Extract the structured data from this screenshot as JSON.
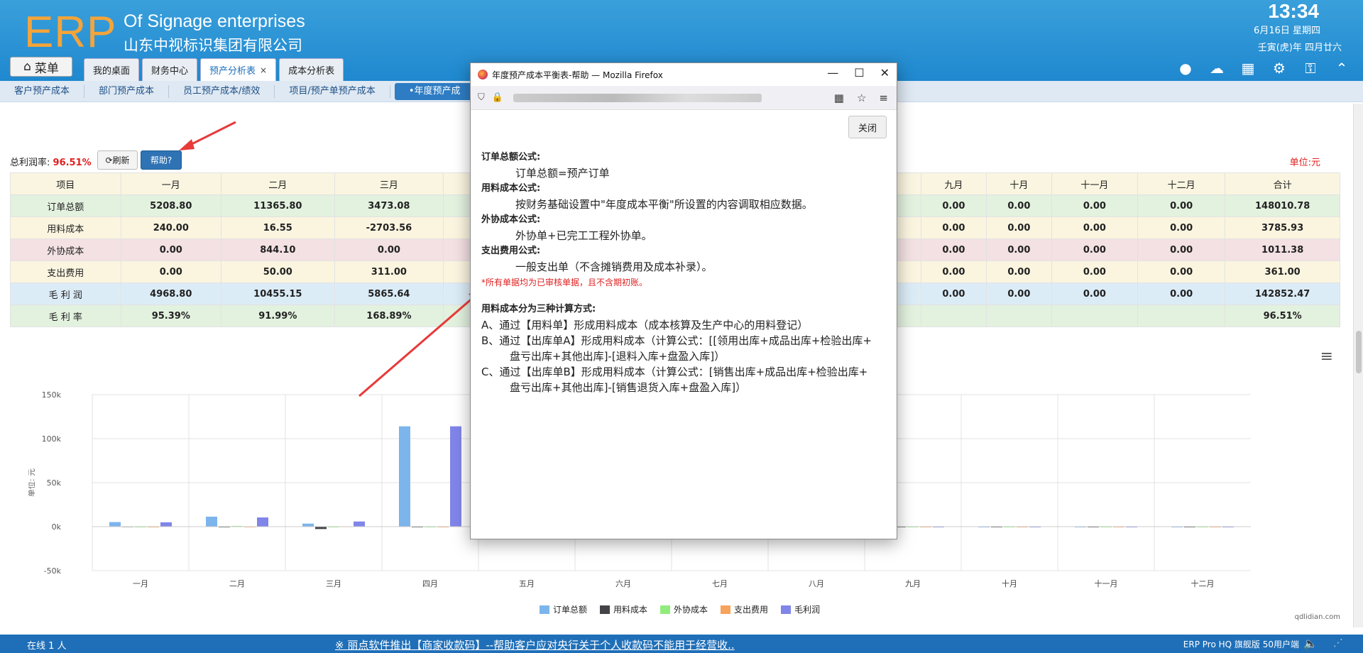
{
  "header": {
    "logo": "ERP",
    "brand_en": "Of Signage enterprises",
    "brand_cn": "山东中视标识集团有限公司",
    "time": "13:34",
    "date": "6月16日 星期四",
    "lunar": "壬寅(虎)年 四月廿六",
    "menu_label": "菜单",
    "tabs": [
      {
        "label": "我的桌面"
      },
      {
        "label": "财务中心"
      },
      {
        "label": "预产分析表",
        "close": "×"
      },
      {
        "label": "成本分析表"
      }
    ]
  },
  "subnav": [
    "客户预产成本",
    "部门预产成本",
    "员工预产成本/绩效",
    "项目/预产单预产成本",
    "•年度预产成"
  ],
  "toolbar": {
    "profit_label": "总利润率:",
    "profit_value": "96.51%",
    "refresh_label": "刷新",
    "help_label": "帮助?",
    "unit": "单位:元"
  },
  "table": {
    "headers": [
      "项目",
      "一月",
      "二月",
      "三月",
      "",
      "九月",
      "十月",
      "十一月",
      "十二月",
      "合计"
    ],
    "rows": [
      {
        "name": "订单总额",
        "cells": [
          "5208.80",
          "11365.80",
          "3473.08",
          "",
          "0.00",
          "0.00",
          "0.00",
          "0.00",
          "148010.78"
        ]
      },
      {
        "name": "用料成本",
        "cells": [
          "240.00",
          "16.55",
          "-2703.56",
          "",
          "0.00",
          "0.00",
          "0.00",
          "0.00",
          "3785.93"
        ]
      },
      {
        "name": "外协成本",
        "cells": [
          "0.00",
          "844.10",
          "0.00",
          "",
          "0.00",
          "0.00",
          "0.00",
          "0.00",
          "1011.38"
        ]
      },
      {
        "name": "支出费用",
        "cells": [
          "0.00",
          "50.00",
          "311.00",
          "",
          "0.00",
          "0.00",
          "0.00",
          "0.00",
          "361.00"
        ]
      },
      {
        "name": "毛 利 润",
        "cells": [
          "4968.80",
          "10455.15",
          "5865.64",
          "",
          "0.00",
          "0.00",
          "0.00",
          "0.00",
          "142852.47"
        ]
      },
      {
        "name": "毛 利 率",
        "cells": [
          "95.39%",
          "91.99%",
          "168.89%",
          "",
          "",
          "",
          "",
          "",
          "96.51%"
        ]
      }
    ]
  },
  "chart_data": {
    "type": "bar",
    "ylabel": "单位: 元",
    "ylim": [
      -50000,
      150000
    ],
    "yticks": [
      "150k",
      "100k",
      "50k",
      "0k",
      "-50k"
    ],
    "categories": [
      "一月",
      "二月",
      "三月",
      "四月",
      "五月",
      "六月",
      "七月",
      "八月",
      "九月",
      "十月",
      "十一月",
      "十二月"
    ],
    "series": [
      {
        "name": "订单总额",
        "color": "#7cb5ec",
        "values": [
          5208.8,
          11365.8,
          3473.08,
          114000,
          0,
          0,
          0,
          0,
          0,
          0,
          0,
          0
        ]
      },
      {
        "name": "用料成本",
        "color": "#434348",
        "values": [
          240,
          16.55,
          -2703.56,
          0,
          0,
          0,
          0,
          0,
          0,
          0,
          0,
          0
        ]
      },
      {
        "name": "外协成本",
        "color": "#90ed7d",
        "values": [
          0,
          844.1,
          0,
          0,
          0,
          0,
          0,
          0,
          0,
          0,
          0,
          0
        ]
      },
      {
        "name": "支出费用",
        "color": "#f7a35c",
        "values": [
          0,
          50,
          311,
          0,
          0,
          0,
          0,
          0,
          0,
          0,
          0,
          0
        ]
      },
      {
        "name": "毛利润",
        "color": "#8085e9",
        "values": [
          4968.8,
          10455.15,
          5865.64,
          114000,
          0,
          0,
          0,
          0,
          0,
          0,
          0,
          0
        ]
      }
    ]
  },
  "credit": "qdlidian.com",
  "footer": {
    "status": "在线  1  人",
    "marquee": "※ 丽点软件推出【商家收款码】--帮助客户应对央行关于个人收款码不能用于经营收..",
    "edition": "ERP Pro HQ 旗舰版 50用户端"
  },
  "popup": {
    "title": "年度预产成本平衡表-帮助 — Mozilla Firefox",
    "close_label": "关闭",
    "sections": [
      {
        "head": "订单总额公式:",
        "body": "订单总额=预产订单"
      },
      {
        "head": "用料成本公式:",
        "body": "按财务基础设置中\"年度成本平衡\"所设置的内容调取相应数据。"
      },
      {
        "head": "外协成本公式:",
        "body": "外协单+已完工工程外协单。"
      },
      {
        "head": "支出费用公式:",
        "body": "一般支出单（不含摊销费用及成本补录）。"
      }
    ],
    "note": "*所有单据均为已审核单据，且不含期初账。",
    "method_head": "用料成本分为三种计算方式:",
    "method_a": "A、通过【用料单】形成用料成本（成本核算及生产中心的用料登记）",
    "method_b1": "B、通过【出库单A】形成用料成本（计算公式：[[领用出库+成品出库+检验出库+",
    "method_b2": "盘亏出库+其他出库]-[退料入库+盘盈入库]）",
    "method_c1": "C、通过【出库单B】形成用料成本（计算公式：[销售出库+成品出库+检验出库+",
    "method_c2": "盘亏出库+其他出库]-[销售退货入库+盘盈入库]）"
  }
}
